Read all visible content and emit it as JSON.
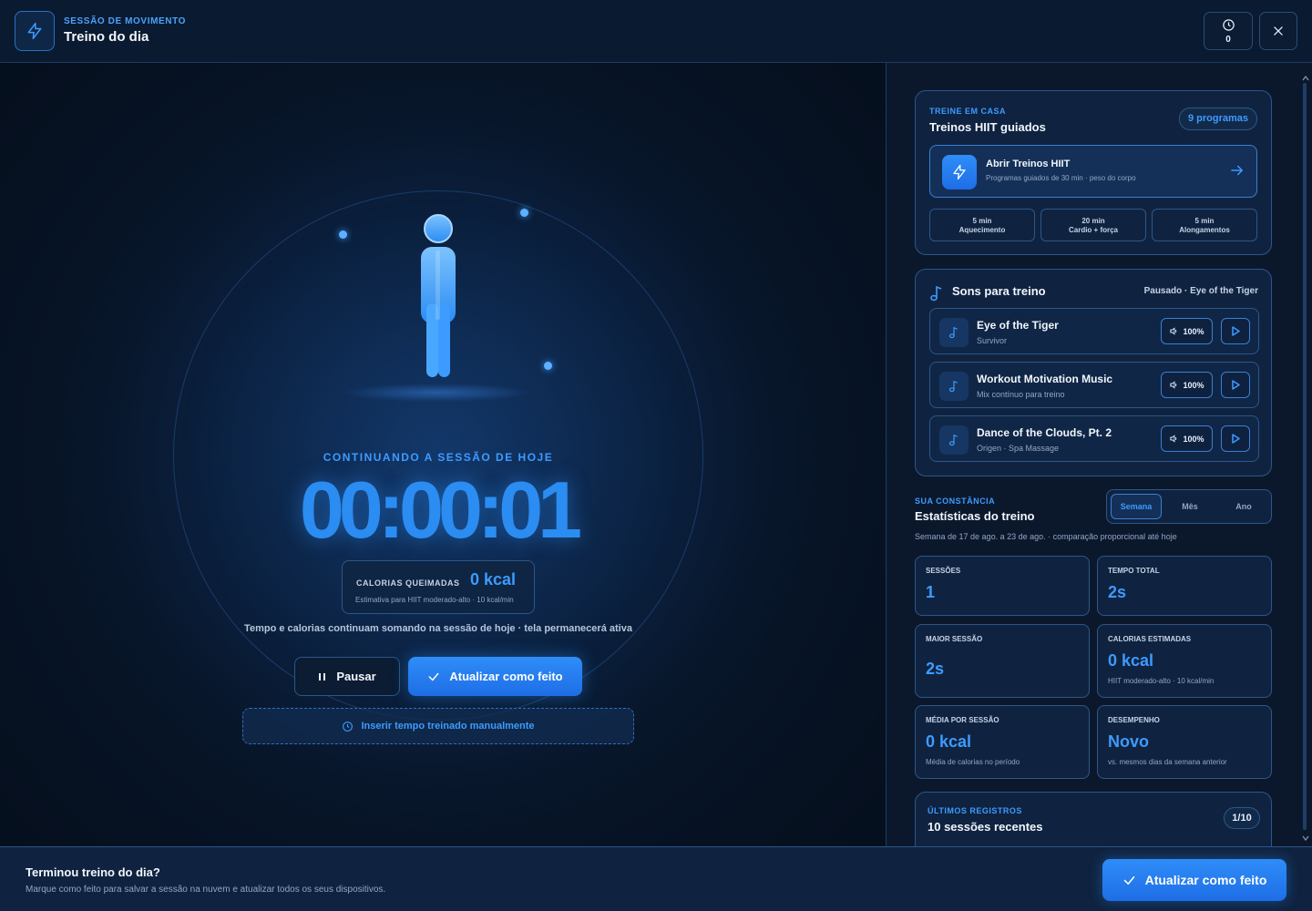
{
  "header": {
    "kicker": "SESSÃO DE MOVIMENTO",
    "title": "Treino do dia",
    "timer_count": "0"
  },
  "session": {
    "kicker": "CONTINUANDO A SESSÃO DE HOJE",
    "elapsed": "00:00:01",
    "calories_label": "CALORIAS QUEIMADAS",
    "calories_value": "0 kcal",
    "calories_note": "Estimativa para HIIT moderado-alto · 10 kcal/min",
    "note": "Tempo e calorias continuam somando na sessão de hoje · tela permanecerá ativa",
    "pause_label": "Pausar",
    "done_label": "Atualizar como feito",
    "manual_label": "Inserir tempo treinado manualmente"
  },
  "hiit": {
    "kicker": "TREINE EM CASA",
    "title": "Treinos HIIT guiados",
    "badge": "9 programas",
    "open_title": "Abrir Treinos HIIT",
    "open_sub": "Programas guiados de 30 min · peso do corpo",
    "chips": [
      {
        "duration": "5 min",
        "label": "Aquecimento"
      },
      {
        "duration": "20 min",
        "label": "Cardio + força"
      },
      {
        "duration": "5 min",
        "label": "Alongamentos"
      }
    ]
  },
  "sounds": {
    "title": "Sons para treino",
    "status": "Pausado · Eye of the Tiger",
    "tracks": [
      {
        "name": "Eye of the Tiger",
        "sub": "Survivor",
        "volume": "100%"
      },
      {
        "name": "Workout Motivation Music",
        "sub": "Mix contínuo para treino",
        "volume": "100%"
      },
      {
        "name": "Dance of the Clouds, Pt. 2",
        "sub": "Origen · Spa Massage",
        "volume": "100%"
      }
    ]
  },
  "stats": {
    "kicker": "SUA CONSTÂNCIA",
    "title": "Estatísticas do treino",
    "periods": [
      "Semana",
      "Mês",
      "Ano"
    ],
    "active_period": "Semana",
    "note": "Semana de 17 de ago. a 23 de ago. · comparação proporcional até hoje",
    "cards": [
      {
        "label": "SESSÕES",
        "value": "1",
        "sub": ""
      },
      {
        "label": "TEMPO TOTAL",
        "value": "2s",
        "sub": ""
      },
      {
        "label": "MAIOR SESSÃO",
        "value": "2s",
        "sub": ""
      },
      {
        "label": "CALORIAS ESTIMADAS",
        "value": "0 kcal",
        "sub": "HIIT moderado-alto · 10 kcal/min"
      },
      {
        "label": "MÉDIA POR SESSÃO",
        "value": "0 kcal",
        "sub": "Média de calorias no período"
      },
      {
        "label": "DESEMPENHO",
        "value": "Novo",
        "sub": "vs. mesmos dias da semana anterior"
      }
    ]
  },
  "recent": {
    "kicker": "ÚLTIMOS REGISTROS",
    "title": "10 sessões recentes",
    "page": "1/10"
  },
  "footer": {
    "title": "Terminou treino do dia?",
    "sub": "Marque como feito para salvar a sessão na nuvem e atualizar todos os seus dispositivos.",
    "button": "Atualizar como feito"
  },
  "colors": {
    "accent": "#2b8cf2",
    "background": "#06101f",
    "panel": "#0f2340"
  }
}
